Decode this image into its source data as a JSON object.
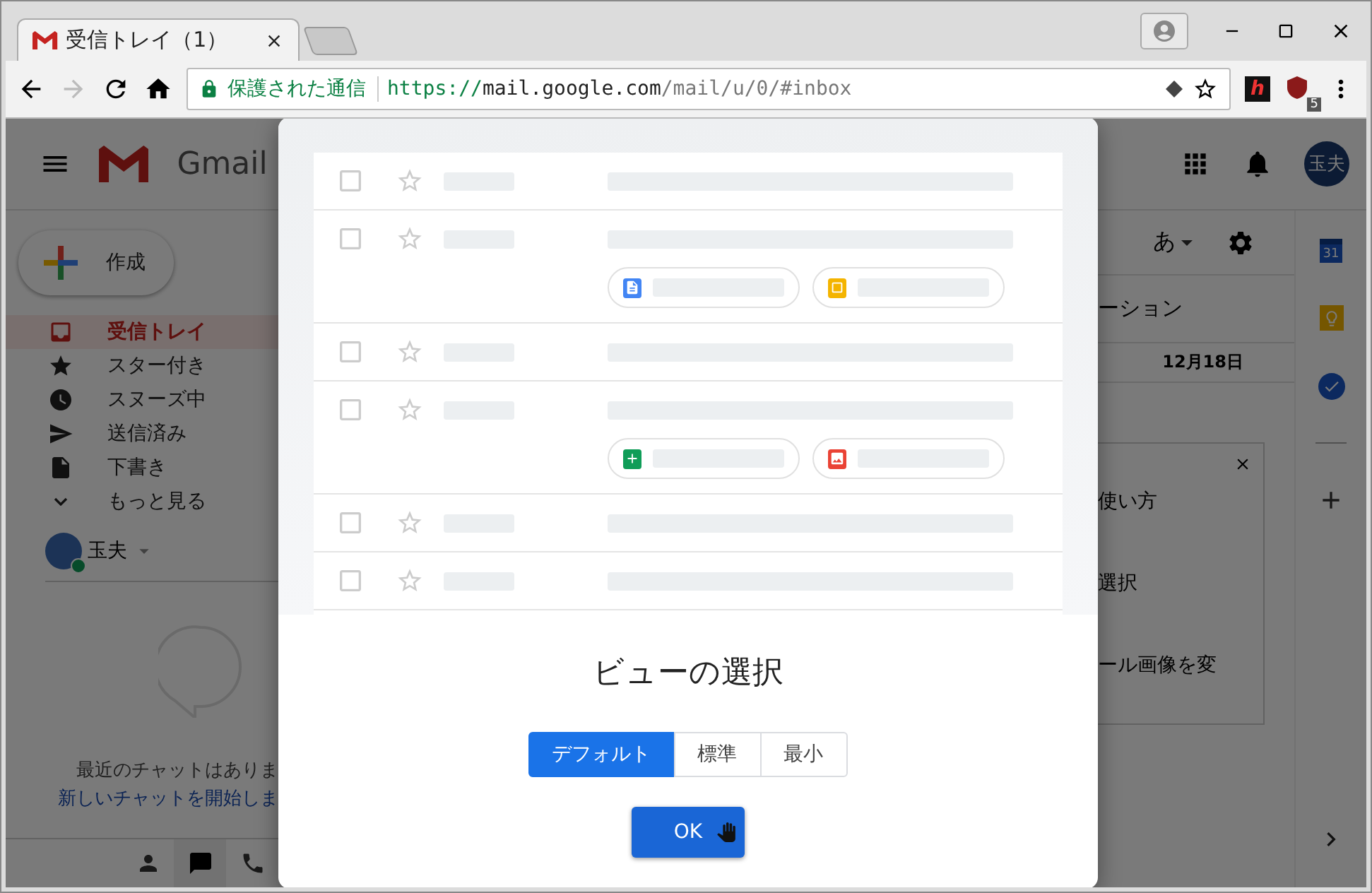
{
  "browser": {
    "tab": {
      "title": "受信トレイ（1）"
    },
    "forward_disabled": true,
    "security_label": "保護された通信",
    "url": {
      "scheme": "https://",
      "host": "mail.google.com",
      "path": "/mail/u/0/#inbox"
    },
    "extensions": [
      {
        "kind": "h",
        "label": "h"
      },
      {
        "kind": "ublock",
        "badge": "5"
      }
    ]
  },
  "gmail": {
    "product": "Gmail",
    "avatar": "玉夫",
    "compose": "作成",
    "nav": [
      {
        "label": "受信トレイ",
        "selected": true
      },
      {
        "label": "スター付き",
        "selected": false
      },
      {
        "label": "スヌーズ中",
        "selected": false
      },
      {
        "label": "送信済み",
        "selected": false
      },
      {
        "label": "下書き",
        "selected": false
      },
      {
        "label": "もっと見る",
        "selected": false
      }
    ],
    "account": {
      "name": "玉夫",
      "online": true
    },
    "chat_empty": [
      "最近のチャットはありま",
      "新しいチャットを開始しま"
    ],
    "bottom_tabs": [
      {
        "selected": false
      },
      {
        "selected": true
      },
      {
        "selected": false
      }
    ],
    "input_tool": "あ",
    "category_tab": "ーション",
    "date": "12月18日",
    "tips": [
      "使い方",
      "選択",
      "ール画像を変"
    ],
    "rail_calendar_day": "31"
  },
  "dialog": {
    "preview_rows": [
      {
        "attachments": []
      },
      {
        "attachments": [
          {
            "kind": "doc"
          },
          {
            "kind": "slides"
          }
        ]
      },
      {
        "attachments": []
      },
      {
        "attachments": [
          {
            "kind": "sheets"
          },
          {
            "kind": "image"
          }
        ]
      },
      {
        "attachments": []
      },
      {
        "attachments": []
      }
    ],
    "title": "ビューの選択",
    "options": [
      {
        "label": "デフォルト",
        "selected": true
      },
      {
        "label": "標準",
        "selected": false
      },
      {
        "label": "最小",
        "selected": false
      }
    ],
    "ok": "OK"
  }
}
